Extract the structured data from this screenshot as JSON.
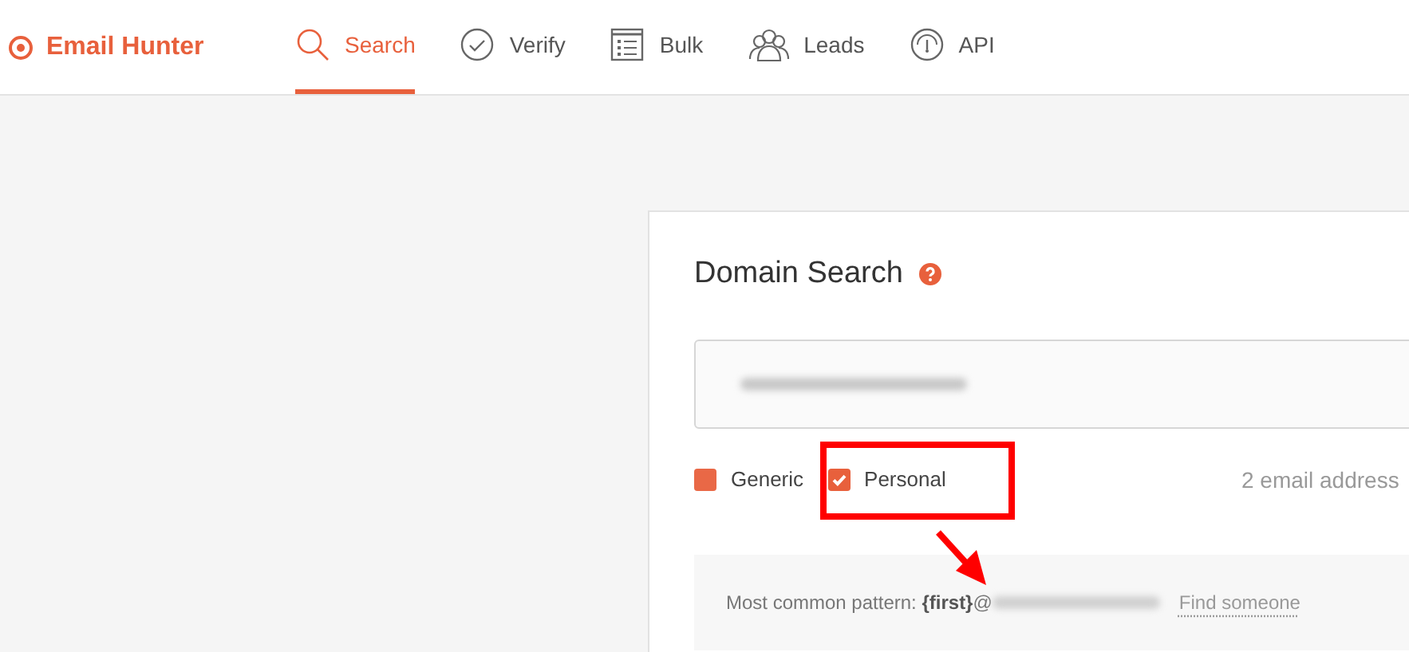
{
  "brand": {
    "name": "Email Hunter"
  },
  "tabs": [
    {
      "label": "Search",
      "kind": "search",
      "selected": true
    },
    {
      "label": "Verify",
      "kind": "verify",
      "selected": false
    },
    {
      "label": "Bulk",
      "kind": "bulk",
      "selected": false
    },
    {
      "label": "Leads",
      "kind": "leads",
      "selected": false
    },
    {
      "label": "API",
      "kind": "api",
      "selected": false
    }
  ],
  "domain_search": {
    "title": "Domain Search",
    "filters": [
      {
        "label": "Generic",
        "checked": false
      },
      {
        "label": "Personal",
        "checked": true
      }
    ],
    "result_count": "2 email address",
    "pattern": {
      "text": "Most common pattern: **{first}**@",
      "link": "Find someone"
    }
  }
}
